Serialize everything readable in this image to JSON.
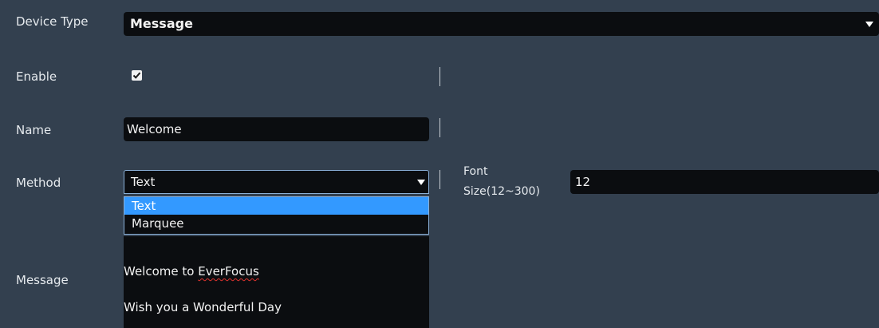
{
  "device_type": {
    "label": "Device Type",
    "value": "Message"
  },
  "enable": {
    "label": "Enable",
    "checked": true
  },
  "name": {
    "label": "Name",
    "value": "Welcome"
  },
  "method": {
    "label": "Method",
    "value": "Text",
    "options": [
      "Text",
      "Marquee"
    ],
    "highlighted_option": "Text"
  },
  "font_size": {
    "label_line1": "Font",
    "label_line2": "Size(12~300)",
    "value": "12"
  },
  "message": {
    "label": "Message",
    "line1_prefix": "Welcome to ",
    "line1_word": "EverFocus",
    "line2": "Wish you a Wonderful Day"
  },
  "colors": {
    "background": "#33404f",
    "field": "#0b0d10",
    "highlight": "#3399ff"
  }
}
